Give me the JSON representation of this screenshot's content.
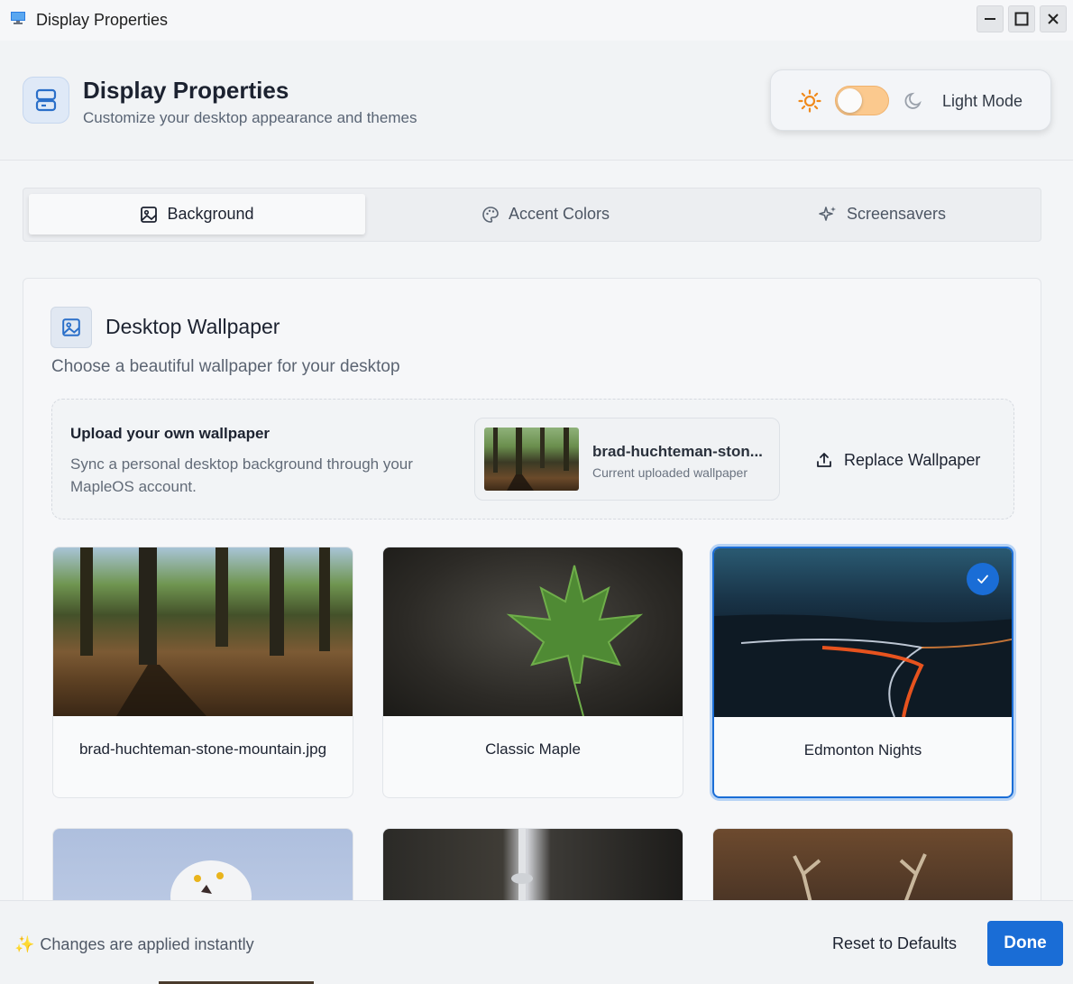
{
  "window": {
    "title": "Display Properties"
  },
  "header": {
    "title": "Display Properties",
    "subtitle": "Customize your desktop appearance and themes",
    "mode_label": "Light Mode",
    "dark_mode_enabled": false
  },
  "tabs": [
    {
      "label": "Background",
      "icon": "image-icon",
      "active": true
    },
    {
      "label": "Accent Colors",
      "icon": "palette-icon",
      "active": false
    },
    {
      "label": "Screensavers",
      "icon": "sparkles-icon",
      "active": false
    }
  ],
  "section": {
    "title": "Desktop Wallpaper",
    "subtitle": "Choose a beautiful wallpaper for your desktop"
  },
  "upload": {
    "title": "Upload your own wallpaper",
    "description": "Sync a personal desktop background through your MapleOS account.",
    "current_name": "brad-huchteman-ston...",
    "current_sub": "Current uploaded wallpaper",
    "replace_label": "Replace Wallpaper"
  },
  "wallpapers": [
    {
      "label": "brad-huchteman-stone-mountain.jpg",
      "selected": false
    },
    {
      "label": "Classic Maple",
      "selected": false
    },
    {
      "label": "Edmonton Nights",
      "selected": true
    }
  ],
  "footer": {
    "note_emoji": "✨",
    "note": "Changes are applied instantly",
    "reset_label": "Reset to Defaults",
    "done_label": "Done"
  },
  "colors": {
    "accent": "#1a6dd6",
    "toggle": "#fbc98e",
    "sun": "#f08a1c"
  }
}
